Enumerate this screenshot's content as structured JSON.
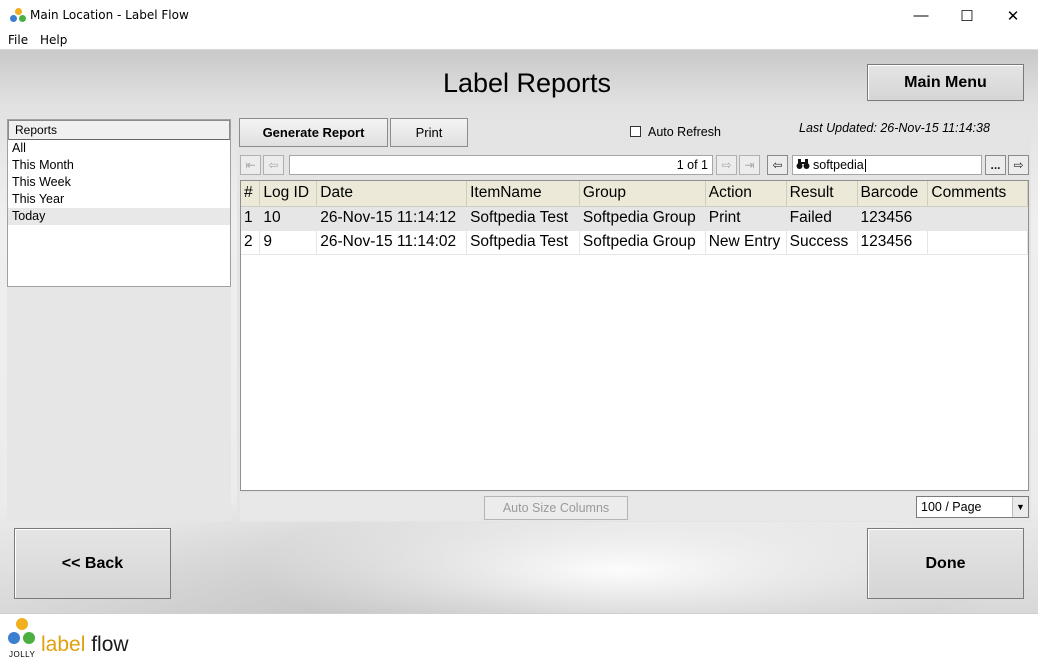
{
  "window": {
    "title": "Main Location - Label Flow",
    "controls": {
      "minimize": "—",
      "maximize": "☐",
      "close": "✕"
    }
  },
  "menu": {
    "file": "File",
    "help": "Help"
  },
  "page": {
    "title": "Label Reports",
    "main_menu": "Main Menu"
  },
  "reports": {
    "header": "Reports",
    "items": [
      "All",
      "This Month",
      "This Week",
      "This Year",
      "Today"
    ],
    "selected": "Today"
  },
  "toolbar": {
    "generate_report": "Generate Report",
    "print": "Print",
    "auto_refresh_label": "Auto Refresh",
    "auto_refresh_checked": false,
    "last_updated_label": "Last Updated:",
    "last_updated_value": "26-Nov-15 11:14:38"
  },
  "navigation": {
    "page_info": "1 of 1",
    "search_value": "softpedia",
    "more_button": "...",
    "first_icon": "⇤",
    "prev_icon": "⇦",
    "next_icon": "⇨",
    "last_icon": "⇥",
    "back_icon": "⇦",
    "forward_icon": "⇨",
    "search_icon": "binoculars-icon"
  },
  "grid": {
    "columns": [
      "#",
      "Log ID",
      "Date",
      "ItemName",
      "Group",
      "Action",
      "Result",
      "Barcode",
      "Comments"
    ],
    "rows": [
      [
        "1",
        "10",
        "26-Nov-15 11:14:12",
        "Softpedia Test",
        "Softpedia Group",
        "Print",
        "Failed",
        "123456",
        ""
      ],
      [
        "2",
        "9",
        "26-Nov-15 11:14:02",
        "Softpedia Test",
        "Softpedia Group",
        "New Entry",
        "Success",
        "123456",
        ""
      ]
    ]
  },
  "bottom": {
    "auto_size": "Auto Size Columns",
    "per_page": "100 / Page"
  },
  "buttons": {
    "back": "<< Back",
    "done": "Done"
  },
  "footer": {
    "brand_part1": "label",
    "brand_part2": "flow",
    "company": "JOLLY"
  },
  "colors": {
    "brand_yellow": "#e0a010",
    "grid_header": "#ece9d8"
  }
}
